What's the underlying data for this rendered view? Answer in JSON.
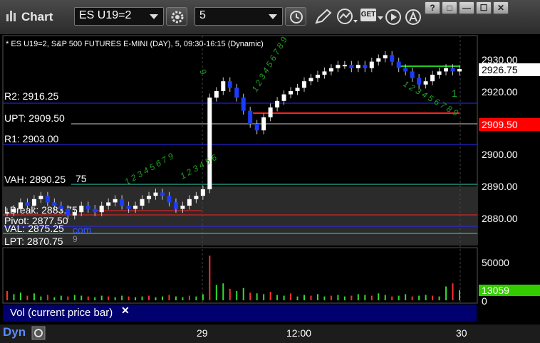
{
  "window": {
    "title": "Chart"
  },
  "toolbar": {
    "symbol": "ES U19=2",
    "interval": "5",
    "get_label": "GET"
  },
  "window_controls": {
    "help": "?",
    "restore": "□",
    "minimize": "—",
    "maximize": "☐",
    "close": "✕"
  },
  "chart_header": "* ES U19=2, S&P 500 FUTURES E-MINI (DAY), 5, 09:30-16:15 (Dynamic)",
  "levels": {
    "r2": "R2: 2916.25",
    "upt": "UPT: 2909.50",
    "r1": "R1: 2903.00",
    "vah": "VAH: 2890.25",
    "vah_suffix": "75",
    "lbreak": "LBreak: 2883.75",
    "pivot": "Pivot: 2877.50",
    "val": "VAL: 2875.25",
    "lpt": "LPT: 2870.75",
    "extra_9": "9",
    "com": "com"
  },
  "price_axis": {
    "ticks": [
      "2930.00",
      "2920.00",
      "2900.00",
      "2890.00",
      "2880.00"
    ],
    "last_price": "2926.75",
    "upt_price": "2909.50"
  },
  "volume_axis": {
    "ticks": [
      "50000",
      "0"
    ],
    "last_volume": "13059"
  },
  "time_axis": [
    "29",
    "12:00",
    "30"
  ],
  "annotations": {
    "count_1": "1"
  },
  "volume_panel": {
    "label": "Vol (current price bar)",
    "close": "✕"
  },
  "status": {
    "left": "Dyn"
  },
  "colors": {
    "bull": "#ffffff",
    "bear": "#1a3cff",
    "support_line": "#2a2aff",
    "red_line": "#ff2020",
    "green_line": "#22cc22",
    "count_text": "#20a020",
    "axis_text": "#ffffff",
    "last_volume_bg": "#33cc00",
    "upt_bg": "#ff0000"
  },
  "chart_data": [
    {
      "type": "candlestick",
      "x_labels": [
        "29",
        "12:00",
        "30"
      ],
      "ylim": [
        2866,
        2934
      ],
      "price_ticks": [
        2880,
        2890,
        2900,
        2920,
        2930
      ],
      "closes": [
        2883,
        2884,
        2886,
        2885,
        2887,
        2888,
        2886,
        2885,
        2884,
        2882,
        2883,
        2885,
        2884,
        2883,
        2885,
        2886,
        2887,
        2885,
        2884,
        2885,
        2887,
        2888,
        2889,
        2888,
        2886,
        2884,
        2885,
        2887,
        2888,
        2890,
        2918,
        2920,
        2923,
        2921,
        2918,
        2914,
        2910,
        2908,
        2912,
        2915,
        2917,
        2919,
        2920,
        2921,
        2923,
        2924,
        2925,
        2926,
        2927,
        2928,
        2928,
        2927,
        2928,
        2927,
        2929,
        2930,
        2931,
        2929,
        2927,
        2926,
        2924,
        2922,
        2923,
        2925,
        2926,
        2927,
        2926,
        2926.75
      ],
      "horizontal_levels": [
        {
          "label": "R2",
          "value": 2916.25
        },
        {
          "label": "UPT",
          "value": 2909.5
        },
        {
          "label": "R1",
          "value": 2903.0
        },
        {
          "label": "VAH",
          "value": 2890.25
        },
        {
          "label": "LBreak",
          "value": 2883.75
        },
        {
          "label": "Pivot",
          "value": 2877.5
        },
        {
          "label": "VAL",
          "value": 2875.25
        },
        {
          "label": "LPT",
          "value": 2870.75
        }
      ],
      "last_price": 2926.75
    },
    {
      "type": "bar",
      "series": "volume",
      "ylim": [
        0,
        60000
      ],
      "y_ticks": [
        0,
        50000
      ],
      "values": [
        12000,
        8000,
        10000,
        6000,
        9000,
        5000,
        7000,
        4000,
        6000,
        5000,
        7000,
        6000,
        5000,
        4000,
        6000,
        5000,
        4000,
        6000,
        5000,
        4000,
        5000,
        6000,
        4000,
        5000,
        7000,
        5000,
        4000,
        6000,
        5000,
        8000,
        58000,
        20000,
        22000,
        15000,
        12000,
        16000,
        10000,
        9000,
        8000,
        11000,
        7000,
        6000,
        9000,
        5000,
        7000,
        6000,
        8000,
        5000,
        6000,
        7000,
        5000,
        6000,
        8000,
        7000,
        6000,
        9000,
        7000,
        5000,
        6000,
        8000,
        5000,
        6000,
        7000,
        6000,
        5000,
        18000,
        22000,
        13059
      ],
      "last_value": 13059
    }
  ]
}
